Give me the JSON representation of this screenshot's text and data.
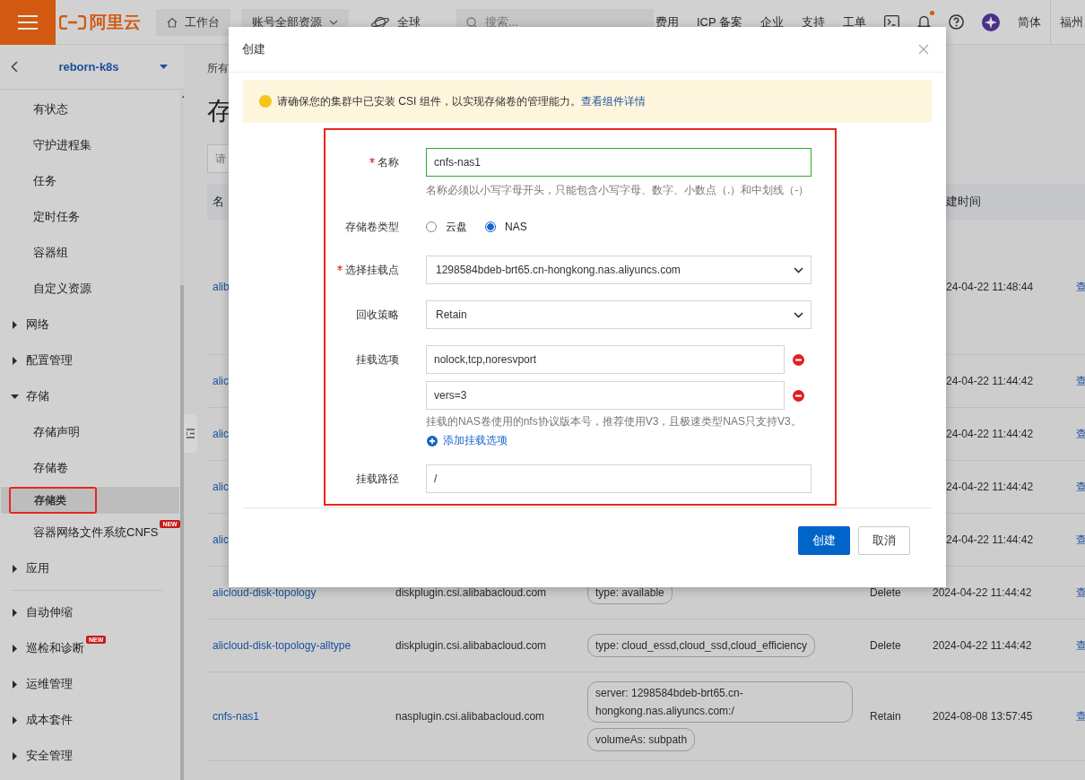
{
  "topbar": {
    "logo": "阿里云",
    "workbench": "工作台",
    "resource_scope": "账号全部资源",
    "region": "全球",
    "search": {
      "placeholder": "搜索..."
    },
    "links": [
      "费用",
      "ICP 备案",
      "企业",
      "支持",
      "工单"
    ],
    "notification": true,
    "language": "简体",
    "account": "福州"
  },
  "sidebar": {
    "cluster": "reborn-k8s",
    "sections": [
      {
        "items": [
          {
            "label": "有状态",
            "kind": "child",
            "selected": false
          },
          {
            "label": "守护进程集",
            "kind": "child",
            "selected": false
          },
          {
            "label": "任务",
            "kind": "child",
            "selected": false
          },
          {
            "label": "定时任务",
            "kind": "child",
            "selected": false
          },
          {
            "label": "容器组",
            "kind": "child",
            "selected": false
          },
          {
            "label": "自定义资源",
            "kind": "child",
            "selected": false
          },
          {
            "label": "网络",
            "kind": "group",
            "expanded": false,
            "selected": false
          },
          {
            "label": "配置管理",
            "kind": "group",
            "expanded": false,
            "selected": false
          },
          {
            "label": "存储",
            "kind": "group",
            "expanded": true,
            "selected": false,
            "children": [
              {
                "label": "存储声明",
                "kind": "child",
                "selected": false
              },
              {
                "label": "存储卷",
                "kind": "child",
                "selected": false
              },
              {
                "label": "存储类",
                "kind": "child",
                "selected": true,
                "highlighted": true
              },
              {
                "label": "容器网络文件系统CNFS",
                "kind": "child",
                "selected": false,
                "badge": "NEW"
              }
            ]
          },
          {
            "label": "应用",
            "kind": "group",
            "expanded": false,
            "selected": false
          }
        ]
      },
      {
        "items": [
          {
            "label": "自动伸缩",
            "kind": "group",
            "expanded": false,
            "selected": false
          },
          {
            "label": "巡检和诊断",
            "kind": "group",
            "expanded": false,
            "selected": false,
            "badge": "NEW"
          },
          {
            "label": "运维管理",
            "kind": "group",
            "expanded": false,
            "selected": false
          },
          {
            "label": "成本套件",
            "kind": "group",
            "expanded": false,
            "selected": false
          },
          {
            "label": "安全管理",
            "kind": "group",
            "expanded": false,
            "selected": false
          }
        ]
      }
    ]
  },
  "page": {
    "breadcrumb": "所有",
    "title": "存",
    "search": {
      "placeholder": "请"
    },
    "table": {
      "header": [
        "名",
        "建时间"
      ],
      "rows": [
        {
          "name": "alib",
          "time": "24-04-22 11:48:44",
          "action": "查"
        },
        {
          "name": "alic",
          "time": "24-04-22 11:44:42",
          "action": "查"
        },
        {
          "name": "alic",
          "time": "24-04-22 11:44:42",
          "action": "查"
        },
        {
          "name": "alic",
          "time": "24-04-22 11:44:42",
          "action": "查"
        },
        {
          "name": "alic",
          "time": "24-04-22 11:44:42",
          "action": "查"
        },
        {
          "name": "alicloud-disk-topology",
          "provisioner": "diskplugin.csi.alibabacloud.com",
          "parameters": [
            "type: available"
          ],
          "reclaim": "Delete",
          "time": "2024-04-22 11:44:42",
          "action": "查"
        },
        {
          "name": "alicloud-disk-topology-alltype",
          "provisioner": "diskplugin.csi.alibabacloud.com",
          "parameters": [
            "type: cloud_essd,cloud_ssd,cloud_efficiency"
          ],
          "reclaim": "Delete",
          "time": "2024-04-22 11:44:42",
          "action": "查"
        },
        {
          "name": "cnfs-nas1",
          "provisioner": "nasplugin.csi.alibabacloud.com",
          "parameters": [
            "server: 1298584bdeb-brt65.cn-hongkong.nas.aliyuncs.com:/",
            "volumeAs: subpath"
          ],
          "reclaim": "Retain",
          "time": "2024-08-08 13:57:45",
          "action": "查"
        }
      ]
    }
  },
  "dialog": {
    "title": "创建",
    "alert": {
      "text": "请确保您的集群中已安装 CSI 组件，以实现存储卷的管理能力。",
      "link": "查看组件详情"
    },
    "highlighted": true,
    "fields": [
      {
        "label": "名称",
        "required": true,
        "kind": "text",
        "value": "cnfs-nas1",
        "valid": true,
        "help": "名称必须以小写字母开头，只能包含小写字母、数字、小数点（.）和中划线（-）"
      },
      {
        "label": "存储卷类型",
        "required": false,
        "kind": "radio",
        "options": [
          {
            "label": "云盘",
            "selected": false
          },
          {
            "label": "NAS",
            "selected": true
          }
        ]
      },
      {
        "label": "选择挂载点",
        "required": true,
        "kind": "select",
        "value": "1298584bdeb-brt65.cn-hongkong.nas.aliyuncs.com"
      },
      {
        "label": "回收策略",
        "required": false,
        "kind": "select",
        "value": "Retain"
      },
      {
        "label": "挂载选项",
        "required": false,
        "kind": "list",
        "values": [
          "nolock,tcp,noresvport",
          "vers=3"
        ],
        "help": "挂载的NAS卷使用的nfs协议版本号，推荐使用V3，且极速类型NAS只支持V3。",
        "add_link": "添加挂载选项"
      },
      {
        "label": "挂载路径",
        "required": false,
        "kind": "text",
        "value": "/",
        "valid": false
      }
    ],
    "buttons": [
      {
        "label": "创建",
        "primary": true
      },
      {
        "label": "取消",
        "primary": false
      }
    ]
  }
}
